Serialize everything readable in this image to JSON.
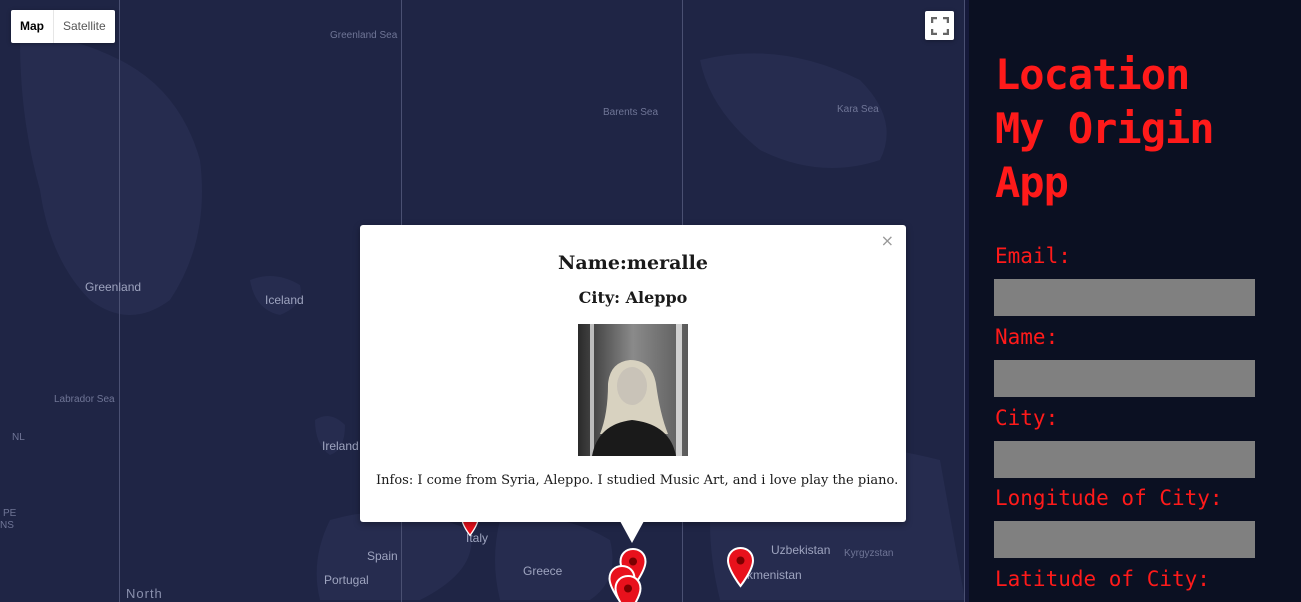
{
  "map": {
    "type_control": {
      "map_label": "Map",
      "satellite_label": "Satellite"
    },
    "labels": {
      "greenland_sea": "Greenland Sea",
      "barents_sea": "Barents Sea",
      "kara_sea": "Kara Sea",
      "greenland": "Greenland",
      "iceland": "Iceland",
      "labrador_sea": "Labrador Sea",
      "nl": "NL",
      "pe": "PE",
      "ns": "NS",
      "ireland": "Ireland",
      "italy": "Italy",
      "spain": "Spain",
      "portugal": "Portugal",
      "greece": "Greece",
      "uzbekistan": "Uzbekistan",
      "kyrgyzstan": "Kyrgyzstan",
      "turkmenistan": "kmenistan",
      "north": "North"
    },
    "marker_color": "#e8111c"
  },
  "infowindow": {
    "name": "Name:meralle",
    "city": "City: Aleppo",
    "infos": "Infos: I come from Syria, Aleppo. I studied Music Art, and i love play the piano.",
    "close_symbol": "×",
    "photo_icon": "portrait-photo"
  },
  "sidebar": {
    "title_line1": "Location",
    "title_line2": "My Origin",
    "title_line3": "App",
    "accent_color": "#ff1a1a",
    "fields": {
      "email_label": "Email:",
      "name_label": "Name:",
      "city_label": "City:",
      "longitude_label": "Longitude of City:",
      "latitude_label": "Latitude of City:"
    }
  }
}
